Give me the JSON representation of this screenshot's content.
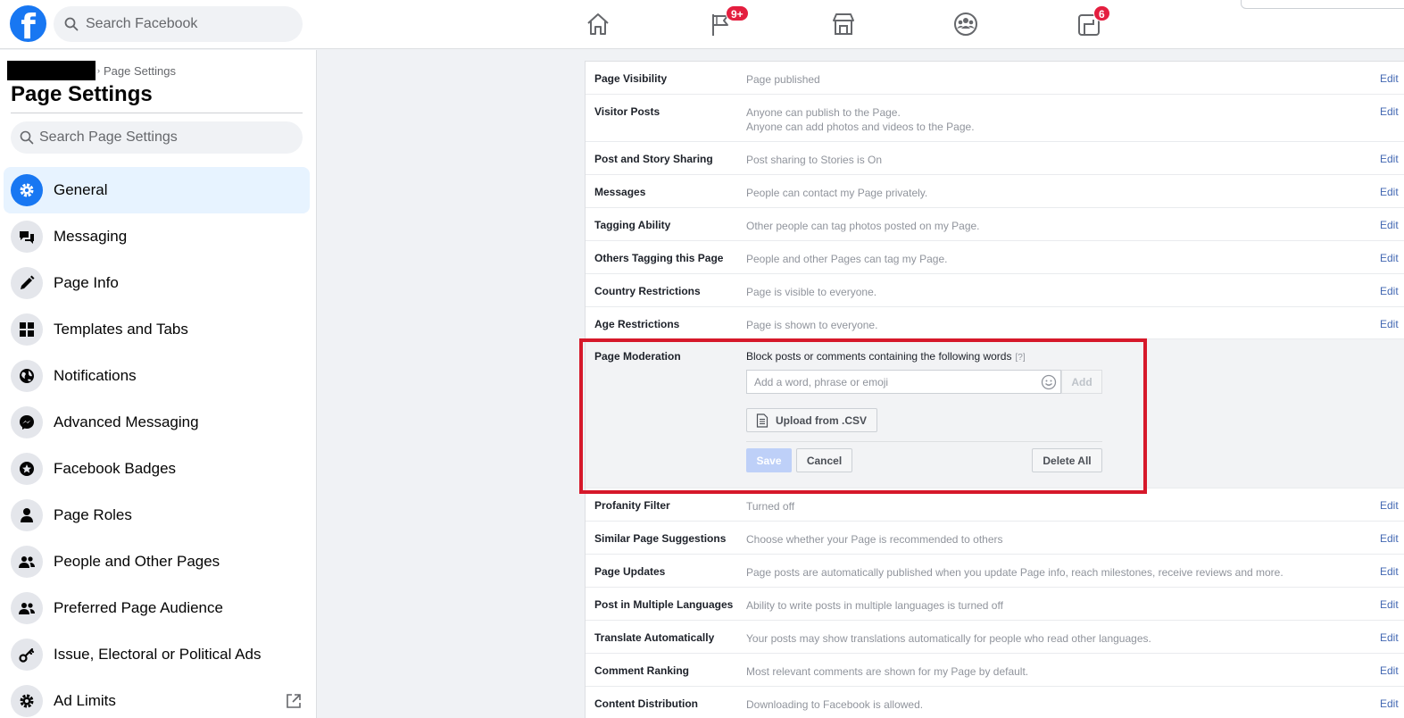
{
  "topbar": {
    "logo_letter": "f",
    "search_placeholder": "Search Facebook",
    "badges": {
      "pages": "9+",
      "gaming": "6"
    }
  },
  "sidebar": {
    "breadcrumb_current": "Page Settings",
    "title": "Page Settings",
    "search_placeholder": "Search Page Settings",
    "items": [
      {
        "label": "General",
        "icon": "gear-icon",
        "active": true
      },
      {
        "label": "Messaging",
        "icon": "chat-bubbles-icon"
      },
      {
        "label": "Page Info",
        "icon": "pencil-icon"
      },
      {
        "label": "Templates and Tabs",
        "icon": "grid-icon"
      },
      {
        "label": "Notifications",
        "icon": "globe-icon"
      },
      {
        "label": "Advanced Messaging",
        "icon": "messenger-icon"
      },
      {
        "label": "Facebook Badges",
        "icon": "star-badge-icon"
      },
      {
        "label": "Page Roles",
        "icon": "person-icon"
      },
      {
        "label": "People and Other Pages",
        "icon": "people-icon"
      },
      {
        "label": "Preferred Page Audience",
        "icon": "people-icon"
      },
      {
        "label": "Issue, Electoral or Political Ads",
        "icon": "key-icon"
      },
      {
        "label": "Ad Limits",
        "icon": "gear-icon"
      }
    ]
  },
  "settings": {
    "edit_label": "Edit",
    "rows_top": [
      {
        "label": "Page Visibility",
        "value": "Page published"
      },
      {
        "label": "Visitor Posts",
        "value": "Anyone can publish to the Page.",
        "value2": "Anyone can add photos and videos to the Page."
      },
      {
        "label": "Post and Story Sharing",
        "value": "Post sharing to Stories is On"
      },
      {
        "label": "Messages",
        "value": "People can contact my Page privately."
      },
      {
        "label": "Tagging Ability",
        "value": "Other people can tag photos posted on my Page."
      },
      {
        "label": "Others Tagging this Page",
        "value": "People and other Pages can tag my Page."
      },
      {
        "label": "Country Restrictions",
        "value": "Page is visible to everyone."
      },
      {
        "label": "Age Restrictions",
        "value": "Page is shown to everyone."
      }
    ],
    "moderation": {
      "label": "Page Moderation",
      "description": "Block posts or comments containing the following words",
      "help": "[?]",
      "input_placeholder": "Add a word, phrase or emoji",
      "add_label": "Add",
      "upload_label": "Upload from .CSV",
      "save_label": "Save",
      "cancel_label": "Cancel",
      "delete_all_label": "Delete All"
    },
    "rows_bottom": [
      {
        "label": "Profanity Filter",
        "value": "Turned off"
      },
      {
        "label": "Similar Page Suggestions",
        "value": "Choose whether your Page is recommended to others"
      },
      {
        "label": "Page Updates",
        "value": "Page posts are automatically published when you update Page info, reach milestones, receive reviews and more."
      },
      {
        "label": "Post in Multiple Languages",
        "value": "Ability to write posts in multiple languages is turned off"
      },
      {
        "label": "Translate Automatically",
        "value": "Your posts may show translations automatically for people who read other languages."
      },
      {
        "label": "Comment Ranking",
        "value": "Most relevant comments are shown for my Page by default."
      },
      {
        "label": "Content Distribution",
        "value": "Downloading to Facebook is allowed."
      }
    ]
  },
  "colors": {
    "brand": "#1877f2",
    "highlight": "#d6182a",
    "link": "#4267b2"
  }
}
